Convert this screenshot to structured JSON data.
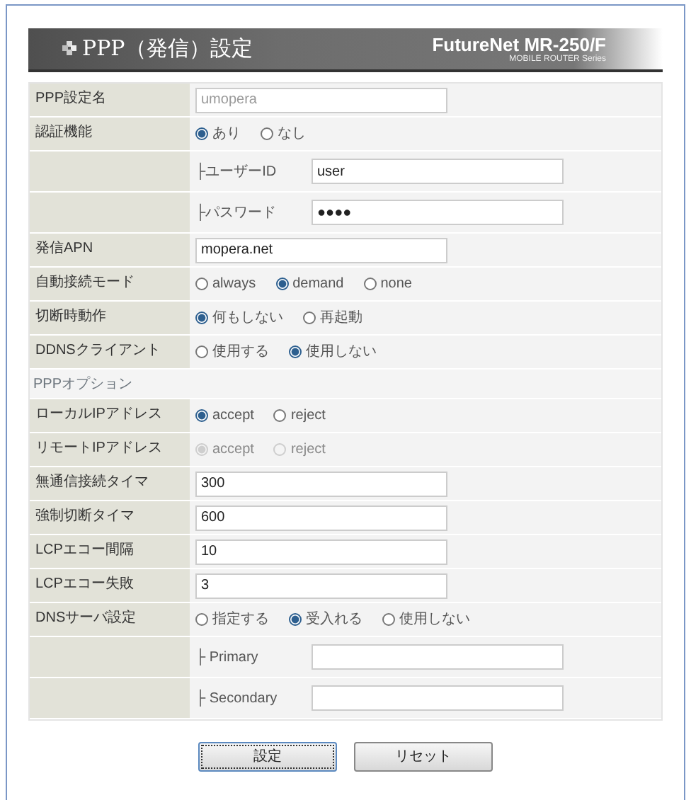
{
  "header": {
    "title": "PPP（発信）設定",
    "brand": "FutureNet MR-250/F",
    "series": "MOBILE ROUTER Series"
  },
  "rows": [
    {
      "kind": "text",
      "label": "PPP設定名",
      "value": "umopera",
      "disabled": true
    },
    {
      "kind": "radio",
      "label": "認証機能",
      "disabled": false,
      "options": [
        {
          "label": "あり",
          "selected": true
        },
        {
          "label": "なし",
          "selected": false
        }
      ]
    },
    {
      "kind": "subfield",
      "label": "├ユーザーID",
      "value": "user"
    },
    {
      "kind": "subfield",
      "label": "├パスワード",
      "value": "●●●●"
    },
    {
      "kind": "text",
      "label": "発信APN",
      "value": "mopera.net",
      "disabled": false
    },
    {
      "kind": "radio",
      "label": "自動接続モード",
      "disabled": false,
      "options": [
        {
          "label": "always",
          "selected": false
        },
        {
          "label": "demand",
          "selected": true
        },
        {
          "label": "none",
          "selected": false
        }
      ]
    },
    {
      "kind": "radio",
      "label": "切断時動作",
      "disabled": false,
      "options": [
        {
          "label": "何もしない",
          "selected": true
        },
        {
          "label": "再起動",
          "selected": false
        }
      ]
    },
    {
      "kind": "radio",
      "label": "DDNSクライアント",
      "disabled": false,
      "options": [
        {
          "label": "使用する",
          "selected": false
        },
        {
          "label": "使用しない",
          "selected": true
        }
      ]
    },
    {
      "kind": "section",
      "label": "PPPオプション"
    },
    {
      "kind": "radio",
      "label": "ローカルIPアドレス",
      "disabled": false,
      "options": [
        {
          "label": "accept",
          "selected": true
        },
        {
          "label": "reject",
          "selected": false
        }
      ]
    },
    {
      "kind": "radio",
      "label": "リモートIPアドレス",
      "disabled": true,
      "options": [
        {
          "label": "accept",
          "selected": true
        },
        {
          "label": "reject",
          "selected": false
        }
      ]
    },
    {
      "kind": "text",
      "label": "無通信接続タイマ",
      "value": "300",
      "disabled": false
    },
    {
      "kind": "text",
      "label": "強制切断タイマ",
      "value": "600",
      "disabled": false
    },
    {
      "kind": "text",
      "label": "LCPエコー間隔",
      "value": "10",
      "disabled": false
    },
    {
      "kind": "text",
      "label": "LCPエコー失敗",
      "value": "3",
      "disabled": false
    },
    {
      "kind": "radio",
      "label": "DNSサーバ設定",
      "disabled": false,
      "options": [
        {
          "label": "指定する",
          "selected": false
        },
        {
          "label": "受入れる",
          "selected": true
        },
        {
          "label": "使用しない",
          "selected": false
        }
      ]
    },
    {
      "kind": "subfield",
      "label": "├ Primary"
    },
    {
      "kind": "subfield",
      "label": "├ Secondary"
    }
  ],
  "buttons": [
    {
      "label": "設定",
      "focused": true
    },
    {
      "label": "リセット",
      "focused": false
    }
  ]
}
